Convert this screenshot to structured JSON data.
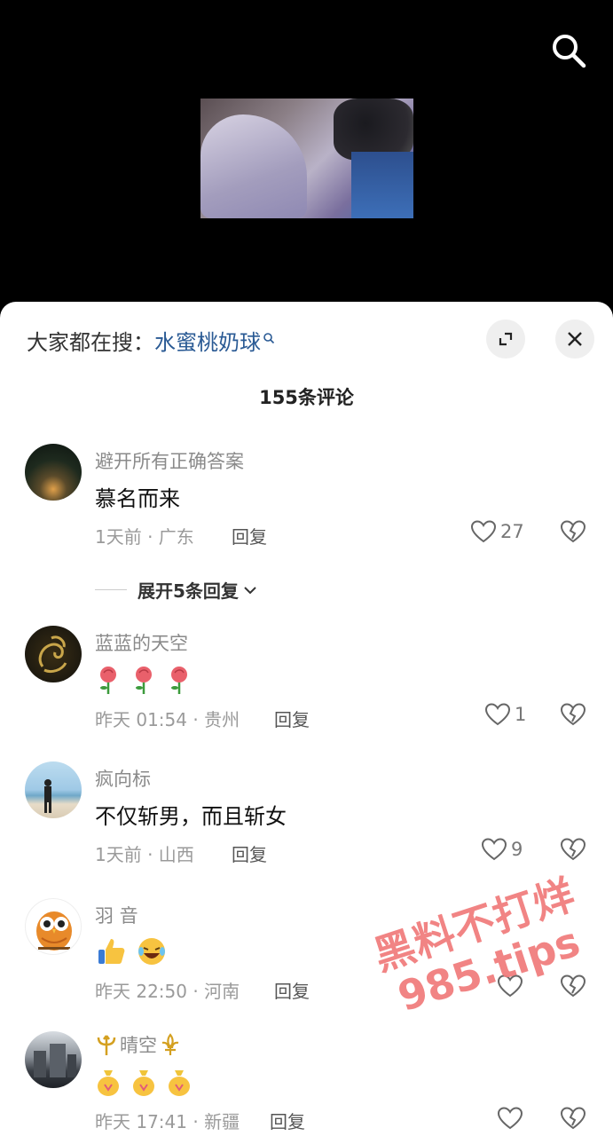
{
  "hot_search": {
    "prefix": "大家都在搜：",
    "keyword": "水蜜桃奶球"
  },
  "comments_title": "155条评论",
  "comments": [
    {
      "user": "避开所有正确答案",
      "text": "慕名而来",
      "meta": "1天前 · 广东",
      "reply": "回复",
      "likes": "27"
    },
    {
      "user": "蓝蓝的天空",
      "meta": "昨天 01:54 · 贵州",
      "reply": "回复",
      "likes": "1"
    },
    {
      "user": "疯向标",
      "text": "不仅斩男，而且斩女",
      "meta": "1天前 · 山西",
      "reply": "回复",
      "likes": "9"
    },
    {
      "user": "羽  音",
      "meta": "昨天 22:50 · 河南",
      "reply": "回复",
      "likes": ""
    },
    {
      "user": "晴空",
      "meta": "昨天 17:41 · 新疆",
      "reply": "回复",
      "likes": ""
    }
  ],
  "expand_replies": "展开5条回复",
  "watermark": {
    "line1": "黑料不打烊",
    "line2": "985.tips"
  },
  "colors": {
    "keyword": "#2a5a94",
    "watermark": "#f07a7a"
  }
}
